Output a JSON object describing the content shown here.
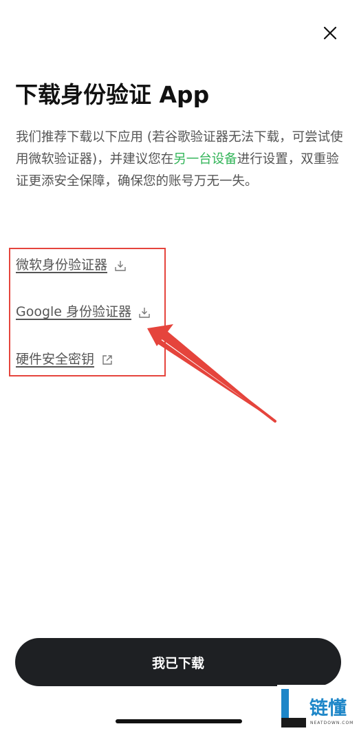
{
  "title": "下载身份验证 App",
  "description": {
    "before_link": "我们推荐下载以下应用 (若谷歌验证器无法下载，可尝试使用微软验证器)，并建议您在",
    "link": "另一台设备",
    "after_link": "进行设置，双重验证更添安全保障，确保您的账号万无一失。"
  },
  "links": [
    {
      "label": "微软身份验证器",
      "icon": "download-icon"
    },
    {
      "label": "Google 身份验证器",
      "icon": "download-icon"
    },
    {
      "label": "硬件安全密钥",
      "icon": "external-link-icon"
    }
  ],
  "primary_button": {
    "label": "我已下载"
  },
  "watermark": {
    "text": "链懂",
    "subtext": "NEATDOWN.COM"
  },
  "colors": {
    "link_green": "#34b55a",
    "button_bg": "#1e2023",
    "annotation_red": "#e5443c",
    "watermark_blue": "#1d86c8"
  }
}
